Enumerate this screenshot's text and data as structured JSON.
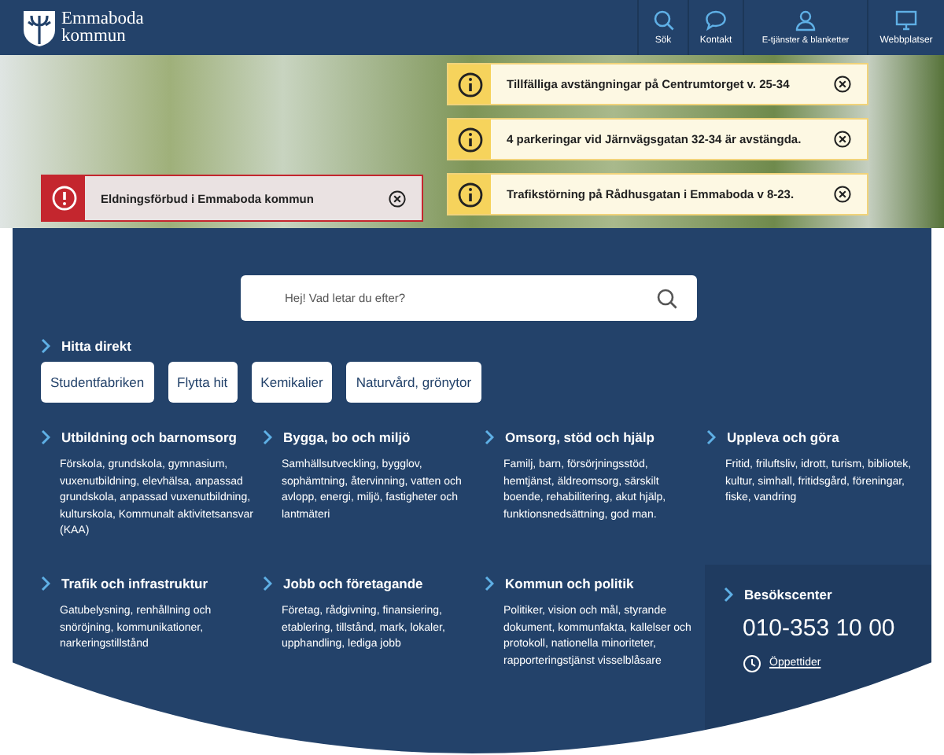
{
  "header": {
    "logo_text": "Emmaboda kommun",
    "nav": [
      {
        "label": "Sök"
      },
      {
        "label": "Kontakt"
      },
      {
        "label": "E-tjänster & blanketter"
      },
      {
        "label": "Webbplatser"
      }
    ]
  },
  "alerts": [
    {
      "kind": "info",
      "text": "Tillfälliga avstängningar på Centrumtorget v. 25-34"
    },
    {
      "kind": "info",
      "text": "4 parkeringar vid Järnvägsgatan 32-34 är avstängda."
    },
    {
      "kind": "warning",
      "text": "Eldningsförbud i Emmaboda kommun"
    },
    {
      "kind": "info",
      "text": "Trafikstörning på Rådhusgatan i Emmaboda v 8-23."
    }
  ],
  "search": {
    "placeholder": "Hej! Vad letar du efter?"
  },
  "quick_links": {
    "title": "Hitta direkt",
    "items": [
      "Studentfabriken",
      "Flytta hit",
      "Kemikalier",
      "Naturvård, grönytor"
    ]
  },
  "categories": [
    {
      "title": "Utbildning och barnomsorg",
      "text": "Förskola, grundskola, gymnasium, vuxenutbildning, elevhälsa, anpassad grundskola, anpassad vuxenutbildning, kulturskola, Kommunalt aktivitetsansvar (KAA)"
    },
    {
      "title": "Bygga, bo och miljö",
      "text": "Samhällsutveckling, bygglov, sophämtning, återvinning, vatten och avlopp, energi, miljö, fastigheter och lantmäteri"
    },
    {
      "title": "Omsorg, stöd och hjälp",
      "text": "Familj, barn, försörjningsstöd, hemtjänst, äldreomsorg, särskilt boende, rehabilitering, akut hjälp, funktionsnedsättning, god man."
    },
    {
      "title": "Uppleva och göra",
      "text": "Fritid, friluftsliv, idrott, turism, bibliotek, kultur, simhall, fritidsgård, föreningar, fiske, vandring"
    },
    {
      "title": "Trafik och infrastruktur",
      "text": "Gatubelysning, renhållning och snöröjning, kommunikationer, narkeringstillstånd"
    },
    {
      "title": "Jobb och företagande",
      "text": "Företag, rådgivning, finansiering, etablering, tillstånd, mark, lokaler, upphandling, lediga jobb"
    },
    {
      "title": "Kommun och politik",
      "text": "Politiker, vision och mål, styrande dokument, kommunfakta, kallelser och protokoll, nationella minoriteter, rapporteringstjänst visselblåsare"
    }
  ],
  "visitor_center": {
    "title": "Besökscenter",
    "phone": "010-353 10 00",
    "link": "Öppettider"
  }
}
